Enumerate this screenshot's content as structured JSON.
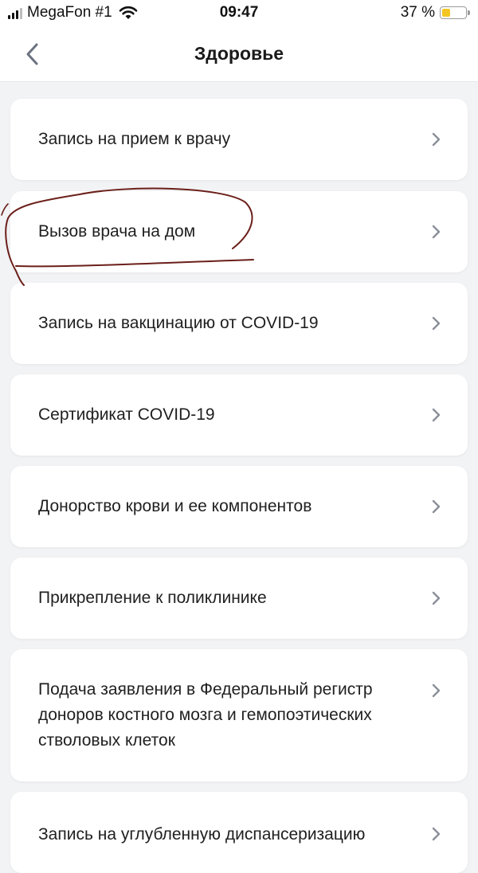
{
  "status": {
    "carrier": "MegaFon #1",
    "time": "09:47",
    "battery_percent": "37 %",
    "battery_level": 0.37,
    "battery_color": "#f3c623"
  },
  "header": {
    "title": "Здоровье",
    "back_icon": "chevron-left-icon"
  },
  "items": [
    {
      "label": "Запись на прием к врачу"
    },
    {
      "label": "Вызов врача на дом"
    },
    {
      "label": "Запись на вакцинацию от COVID-19"
    },
    {
      "label": "Сертификат COVID-19"
    },
    {
      "label": "Донорство крови и ее компонентов"
    },
    {
      "label": "Прикрепление к поликлинике"
    },
    {
      "label": "Подача заявления в Федеральный регистр доноров костного мозга и гемопоэтических стволовых клеток"
    },
    {
      "label": "Запись на углубленную диспансеризацию"
    }
  ],
  "colors": {
    "background": "#f2f3f5",
    "card": "#ffffff",
    "chevron": "#8a8f99",
    "annotation": "#6b1f1a"
  }
}
